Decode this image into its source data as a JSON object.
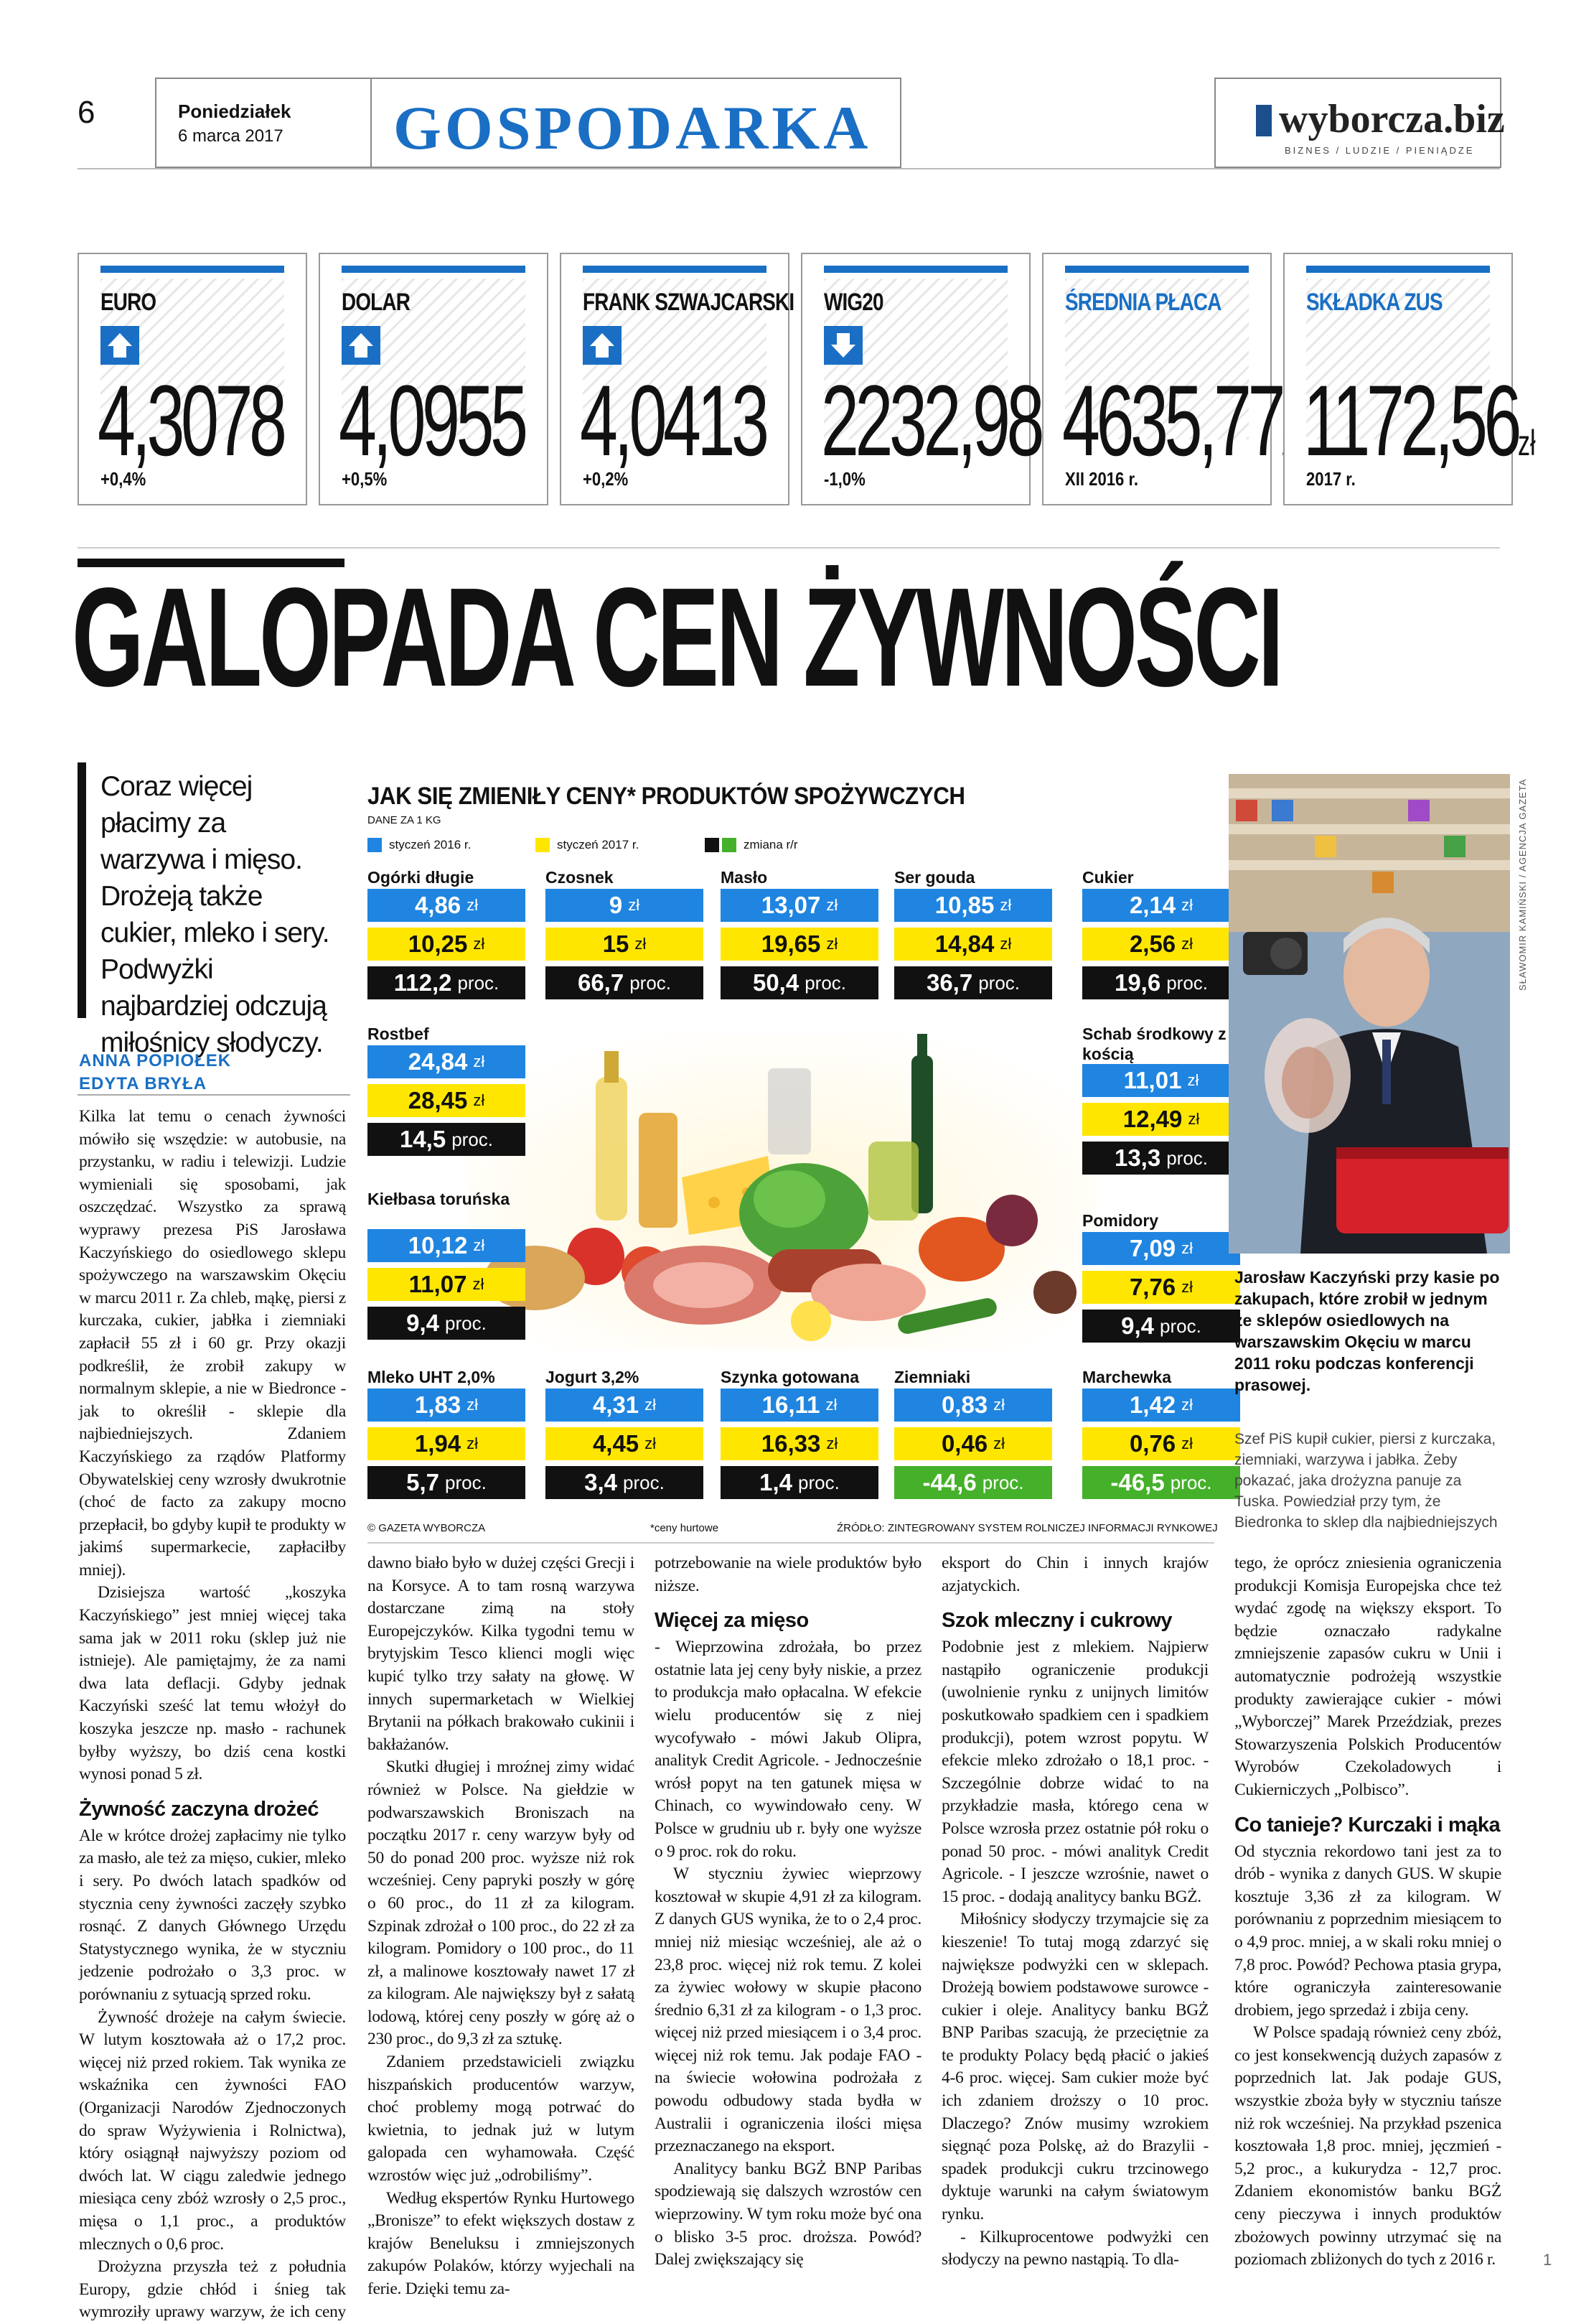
{
  "page": {
    "number": "6",
    "day": "Poniedziałek",
    "date": "6 marca 2017",
    "section": "GOSPODARKA"
  },
  "logo": {
    "text": "wyborcza.biz",
    "tagline": "BIZNES / LUDZIE / PIENIĄDZE"
  },
  "colors": {
    "accent_blue": "#1a6fc4",
    "box_2016": "#1f85e0",
    "box_2017": "#ffe600",
    "box_change": "#111111",
    "box_negative": "#45b12a"
  },
  "ticker": [
    {
      "label": "EURO",
      "arrow": "up-arrow",
      "value": "4,3078",
      "unit": "",
      "change": "+0,4%",
      "highlight": false
    },
    {
      "label": "DOLAR",
      "arrow": "up-arrow",
      "value": "4,0955",
      "unit": "",
      "change": "+0,5%",
      "highlight": false
    },
    {
      "label": "FRANK SZWAJCARSKI",
      "arrow": "up-arrow",
      "value": "4,0413",
      "unit": "",
      "change": "+0,2%",
      "highlight": false
    },
    {
      "label": "WIG20",
      "arrow": "down-arrow",
      "value": "2232,98",
      "unit": "",
      "change": "-1,0%",
      "highlight": false
    },
    {
      "label": "ŚREDNIA PŁACA",
      "arrow": "",
      "value": "4635,77",
      "unit": "zł",
      "change": "XII 2016 r.",
      "highlight": true
    },
    {
      "label": "SKŁADKA ZUS",
      "arrow": "",
      "value": "1172,56",
      "unit": "zł",
      "change": "2017 r.",
      "highlight": true
    }
  ],
  "headline": "GALOPADA CEN ŻYWNOŚCI",
  "lead": "Coraz więcej płacimy za warzywa i mięso. Drożeją także cukier, mleko i sery. Podwyżki najbardziej odczują miłośnicy słodyczy.",
  "authors": [
    "ANNA POPIOŁEK",
    "EDYTA BRYŁA"
  ],
  "infographic": {
    "title": "JAK SIĘ ZMIENIŁY CENY* PRODUKTÓW SPOŻYWCZYCH",
    "subtitle": "DANE ZA 1 KG",
    "legend": [
      "styczeń 2016 r.",
      "styczeń 2017 r.",
      "zmiana r/r"
    ],
    "currency": "zł",
    "percent_unit": "proc.",
    "copyright": "© GAZETA WYBORCZA",
    "footnote": "*ceny hurtowe",
    "source": "ŹRÓDŁO: ZINTEGROWANY SYSTEM ROLNICZEJ INFORMACJI RYNKOWEJ",
    "products": [
      {
        "name": "Ogórki długie",
        "p2016": "4,86",
        "p2017": "10,25",
        "change": "112,2",
        "negative": false
      },
      {
        "name": "Czosnek",
        "p2016": "9",
        "p2017": "15",
        "change": "66,7",
        "negative": false
      },
      {
        "name": "Masło",
        "p2016": "13,07",
        "p2017": "19,65",
        "change": "50,4",
        "negative": false
      },
      {
        "name": "Ser gouda",
        "p2016": "10,85",
        "p2017": "14,84",
        "change": "36,7",
        "negative": false
      },
      {
        "name": "Cukier",
        "p2016": "2,14",
        "p2017": "2,56",
        "change": "19,6",
        "negative": false
      },
      {
        "name": "Rostbef",
        "p2016": "24,84",
        "p2017": "28,45",
        "change": "14,5",
        "negative": false
      },
      {
        "name": "Schab środkowy z kością",
        "p2016": "11,01",
        "p2017": "12,49",
        "change": "13,3",
        "negative": false
      },
      {
        "name": "Kiełbasa toruńska",
        "p2016": "10,12",
        "p2017": "11,07",
        "change": "9,4",
        "negative": false
      },
      {
        "name": "Pomidory",
        "p2016": "7,09",
        "p2017": "7,76",
        "change": "9,4",
        "negative": false
      },
      {
        "name": "Mleko UHT 2,0%",
        "p2016": "1,83",
        "p2017": "1,94",
        "change": "5,7",
        "negative": false
      },
      {
        "name": "Jogurt 3,2%",
        "p2016": "4,31",
        "p2017": "4,45",
        "change": "3,4",
        "negative": false
      },
      {
        "name": "Szynka gotowana",
        "p2016": "16,11",
        "p2017": "16,33",
        "change": "1,4",
        "negative": false
      },
      {
        "name": "Ziemniaki",
        "p2016": "0,83",
        "p2017": "0,46",
        "change": "-44,6",
        "negative": true
      },
      {
        "name": "Marchewka",
        "p2016": "1,42",
        "p2017": "0,76",
        "change": "-46,5",
        "negative": true
      }
    ]
  },
  "chart_data": {
    "type": "table",
    "title": "JAK SIĘ ZMIENIŁY CENY* PRODUKTÓW SPOŻYWCZYCH",
    "subtitle": "DANE ZA 1 KG",
    "columns": [
      "styczeń 2016 r.",
      "styczeń 2017 r.",
      "zmiana r/r"
    ],
    "rows": [
      [
        "Ogórki długie",
        4.86,
        10.25,
        112.2
      ],
      [
        "Czosnek",
        9,
        15,
        66.7
      ],
      [
        "Masło",
        13.07,
        19.65,
        50.4
      ],
      [
        "Ser gouda",
        10.85,
        14.84,
        36.7
      ],
      [
        "Cukier",
        2.14,
        2.56,
        19.6
      ],
      [
        "Rostbef",
        24.84,
        28.45,
        14.5
      ],
      [
        "Schab środkowy z kością",
        11.01,
        12.49,
        13.3
      ],
      [
        "Kiełbasa toruńska",
        10.12,
        11.07,
        9.4
      ],
      [
        "Pomidory",
        7.09,
        7.76,
        9.4
      ],
      [
        "Mleko UHT 2,0%",
        1.83,
        1.94,
        5.7
      ],
      [
        "Jogurt 3,2%",
        4.31,
        4.45,
        3.4
      ],
      [
        "Szynka gotowana",
        16.11,
        16.33,
        1.4
      ],
      [
        "Ziemniaki",
        0.83,
        0.46,
        -44.6
      ],
      [
        "Marchewka",
        1.42,
        0.76,
        -46.5
      ]
    ]
  },
  "photo": {
    "credit": "SŁAWOMIR KAMIŃSKI / AGENCJA GAZETA",
    "caption": "Jarosław Kaczyński przy kasie po zakupach, które zrobił w jednym ze sklepów osiedlowych na warszawskim Okęciu w marcu 2011 roku podczas konferencji prasowej.",
    "caption2": "Szef PiS kupił cukier, piersi z kurczaka, ziemniaki, warzywa i jabłka. Żeby pokazać, jaka drożyzna panuje za Tuska. Powiedział przy tym, że Biedronka to sklep dla najbiedniejszych"
  },
  "article": {
    "col1": [
      {
        "type": "p",
        "noindent": true,
        "text": "Kilka lat temu o cenach żywności mówiło się wszędzie: w autobusie, na przystanku, w radiu i telewizji. Ludzie wymieniali się sposobami, jak oszczędzać. Wszystko za sprawą wyprawy prezesa PiS Jarosława Kaczyńskiego do osiedlowego sklepu spożywczego na warszawskim Okęciu w marcu 2011 r. Za chleb, mąkę, piersi z kurczaka, cukier, jabłka i ziemniaki zapłacił 55 zł i 60 gr. Przy okazji podkreślił, że zrobił zakupy w normalnym sklepie, a nie w Biedronce - jak to określił - sklepie dla najbiedniejszych. Zdaniem Kaczyńskiego za rządów Platformy Obywatelskiej ceny wzrosły dwukrotnie (choć de facto za zakupy mocno przepłacił, bo gdyby kupił te produkty w jakimś supermarkecie, zapłaciłby mniej)."
      },
      {
        "type": "p",
        "text": "Dzisiejsza wartość „koszyka Kaczyńskiego” jest mniej więcej taka sama jak w 2011 roku (sklep już nie istnieje). Ale pamiętajmy, że za nami dwa lata deflacji. Gdyby jednak Kaczyński sześć lat temu włożył do koszyka jeszcze np. masło - rachunek byłby wyższy, bo dziś cena kostki wynosi ponad 5 zł."
      },
      {
        "type": "h",
        "text": "Żywność zaczyna drożeć"
      },
      {
        "type": "p",
        "noindent": true,
        "text": "Ale w krótce drożej zapłacimy nie tylko za masło, ale też za mięso, cukier, mleko i sery. Po dwóch latach spadków od stycznia ceny żywności zaczęły szybko rosnąć. Z danych Głównego Urzędu Statystycznego wynika, że w styczniu jedzenie podrożało o 3,3 proc. w porównaniu z sytuacją sprzed roku."
      },
      {
        "type": "p",
        "text": "Żywność drożeje na całym świecie. W lutym kosztowała aż o 17,2 proc. więcej niż przed rokiem. Tak wynika ze wskaźnika cen żywności FAO (Organizacji Narodów Zjednoczonych do spraw Wyżywienia i Rolnictwa), który osiągnął najwyższy poziom od dwóch lat. W ciągu zaledwie jednego miesiąca ceny zbóż wzrosły o 2,5 proc., mięsa o 1,1 proc., a produktów mlecznych o 0,6 proc."
      },
      {
        "type": "p",
        "text": "Drożyzna przyszła też z południa Europy, gdzie chłód i śnieg tak wymroziły uprawy warzyw, że ich ceny rekordowo wzrosły. Jeszcze nie-"
      }
    ],
    "col2": [
      {
        "type": "p",
        "noindent": true,
        "text": "dawno biało było w dużej części Grecji i na Korsyce. A to tam rosną warzywa dostarczane zimą na stoły Europejczyków. Kilka tygodni temu w brytyjskim Tesco klienci mogli więc kupić tylko trzy sałaty na głowę. W innych supermarketach w Wielkiej Brytanii na półkach brakowało cukinii i bakłażanów."
      },
      {
        "type": "p",
        "text": "Skutki długiej i mroźnej zimy widać również w Polsce. Na giełdzie w podwarszawskich Broniszach na początku 2017 r. ceny warzyw były od 50 do ponad 200 proc. wyższe niż rok wcześniej. Ceny papryki poszły w górę o 60 proc., do 11 zł za kilogram. Szpinak zdrożał o 100 proc., do 22 zł za kilogram. Pomidory o 100 proc., do 11 zł, a malinowe kosztowały nawet 17 zł za kilogram. Ale największy był z sałatą lodową, której ceny poszły w górę aż o 230 proc., do 9,3 zł za sztukę."
      },
      {
        "type": "p",
        "text": "Zdaniem przedstawicieli związku hiszpańskich producentów warzyw, choć problemy mogą potrwać do kwietnia, to jednak już w lutym galopada cen wyhamowała. Część wzrostów więc już „odrobiliśmy”."
      },
      {
        "type": "p",
        "text": "Według ekspertów Rynku Hurtowego „Bronisze” to efekt większych dostaw z krajów Beneluksu i zmniejszonych zakupów Polaków, którzy wyjechali na ferie. Dzięki temu za-"
      }
    ],
    "col3": [
      {
        "type": "p",
        "noindent": true,
        "text": "potrzebowanie na wiele produktów było niższe."
      },
      {
        "type": "h",
        "text": "Więcej za mięso"
      },
      {
        "type": "p",
        "noindent": true,
        "text": "- Wieprzowina zdrożała, bo przez ostatnie lata jej ceny były niskie, a przez to produkcja mało opłacalna. W efekcie wielu producentów się z niej wycofywało - mówi Jakub Olipra, analityk Credit Agricole. - Jednocześnie wrósł popyt na ten gatunek mięsa w Chinach, co wywindowało ceny. W Polsce w grudniu ub r. były one wyższe o 9 proc. rok do roku."
      },
      {
        "type": "p",
        "text": "W styczniu żywiec wieprzowy kosztował w skupie 4,91 zł za kilogram. Z danych GUS wynika, że to o 2,4 proc. mniej niż miesiąc wcześniej, ale aż o 23,8 proc. więcej niż rok temu. Z kolei za żywiec wołowy w skupie płacono średnio 6,31 zł za kilogram - o 1,3 proc. więcej niż przed miesiącem i o 3,4 proc. więcej niż rok temu. Jak podaje FAO - na świecie wołowina podrożała z powodu odbudowy stada bydła w Australii i ograniczenia ilości mięsa przeznaczanego na eksport."
      },
      {
        "type": "p",
        "text": "Analitycy banku BGŻ BNP Paribas spodziewają się dalszych wzrostów cen wieprzowiny. W tym roku może być ona o blisko 3-5 proc. droższa. Powód? Dalej zwiększający się"
      }
    ],
    "col4": [
      {
        "type": "p",
        "noindent": true,
        "text": "eksport do Chin i innych krajów azjatyckich."
      },
      {
        "type": "h",
        "text": "Szok mleczny i cukrowy"
      },
      {
        "type": "p",
        "noindent": true,
        "text": "Podobnie jest z mlekiem. Najpierw nastąpiło ograniczenie produkcji (uwolnienie rynku z unijnych limitów poskutkowało spadkiem cen i spadkiem produkcji), potem wzrost popytu. W efekcie mleko zdrożało o 18,1 proc. - Szczególnie dobrze widać to na przykładzie masła, którego cena w Polsce wzrosła przez ostatnie pół roku o ponad 50 proc. - mówi analityk Credit Agricole. - I jeszcze wzrośnie, nawet o 15 proc. - dodają analitycy banku BGŻ."
      },
      {
        "type": "p",
        "text": "Miłośnicy słodyczy trzymajcie się za kieszenie! To tutaj mogą zdarzyć się największe podwyżki cen w sklepach. Drożeją bowiem podstawowe surowce - cukier i oleje. Analitycy banku BGŻ BNP Paribas szacują, że przeciętnie za te produkty Polacy będą płacić o jakieś 4-6 proc. więcej. Sam cukier może być ich zdaniem droższy o 10 proc. Dlaczego? Znów musimy wzrokiem sięgnąć poza Polskę, aż do Brazylii - spadek produkcji cukru trzcinowego dyktuje warunki na całym światowym rynku."
      },
      {
        "type": "p",
        "text": "- Kilkuprocentowe podwyżki cen słodyczy na pewno nastąpią. To dla-"
      }
    ],
    "col5": [
      {
        "type": "p",
        "noindent": true,
        "text": "tego, że oprócz zniesienia ograniczenia produkcji Komisja Europejska chce też wydać zgodę na większy eksport. To będzie oznaczało radykalne zmniejszenie zapasów cukru w Unii i automatycznie podrożeją wszystkie produkty zawierające cukier - mówi „Wyborczej” Marek Przeździak, prezes Stowarzyszenia Polskich Producentów Wyrobów Czekoladowych i Cukierniczych „Polbisco”."
      },
      {
        "type": "h",
        "text": "Co tanieje? Kurczaki i mąka"
      },
      {
        "type": "p",
        "noindent": true,
        "text": "Od stycznia rekordowo tani jest za to drób - wynika z danych GUS. W skupie kosztuje 3,36 zł za kilogram. W porównaniu z poprzednim miesiącem to o 4,9 proc. mniej, a w skali roku mniej o 7,8 proc. Powód? Pechowa ptasia grypa, które ograniczyła zainteresowanie drobiem, jego sprzedaż i zbija ceny."
      },
      {
        "type": "p",
        "text": "W Polsce spadają również ceny zbóż, co jest konsekwencją dużych zapasów z poprzednich lat. Jak podaje GUS, wszystkie zboża były w styczniu tańsze niż rok wcześniej. Na przykład pszenica kosztowała 1,8 proc. mniej, jęczmień - 5,2 proc., a kukurydza - 12,7 proc. Zdaniem ekonomistów banku BGŻ ceny pieczywa i innych produktów zbożowych powinny utrzymać się na poziomach zbliżonych do tych z 2016 r."
      }
    ]
  },
  "end_mark": "1"
}
